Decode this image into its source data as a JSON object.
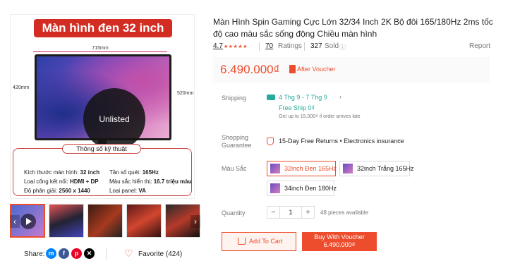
{
  "gallery": {
    "banner_title": "Màn hình đen 32 inch",
    "dim_width": "715mm",
    "dim_height_left": "420mm",
    "dim_height_right": "520mm",
    "watermark": "Unlisted",
    "spec_title": "Thông số kỹ thuật",
    "specs": [
      {
        "label": "Kích thước màn hình: ",
        "value": "32 inch"
      },
      {
        "label": "Tần số quét: ",
        "value": "165Hz"
      },
      {
        "label": "Loại cổng kết nối: ",
        "value": "HDMI + DP"
      },
      {
        "label": "Màu sắc hiển thị: ",
        "value": "16.7 triệu màu"
      },
      {
        "label": "Độ phân giải: ",
        "value": "2560 x 1440"
      },
      {
        "label": "Loại panel: ",
        "value": "VA"
      }
    ],
    "nav_prev": "‹",
    "nav_next": "›"
  },
  "share": {
    "label": "Share:",
    "icons": [
      "messenger-icon",
      "facebook-icon",
      "pinterest-icon",
      "x-icon"
    ],
    "icon_glyphs": [
      "m",
      "f",
      "p",
      "✕"
    ]
  },
  "favorite": {
    "label": "Favorite (424)",
    "heart": "♡"
  },
  "product": {
    "title": "Màn Hình Spin Gaming Cực Lớn 32/34 Inch 2K Bộ đôi 165/180Hz 2ms tốc độ cao màu sắc sống động Chiều màn hình",
    "rating": "4.7",
    "stars": "★★★★★",
    "ratings_count": "70",
    "ratings_label": "Ratings",
    "sold_count": "327",
    "sold_label": "Sold",
    "info_glyph": "ⓘ",
    "report": "Report",
    "price": "6.490.000₫",
    "after_voucher": "After Voucher"
  },
  "shipping": {
    "label": "Shipping",
    "date": "4 Thg 9 - 7 Thg 9",
    "free_ship": "Free Ship 0₫",
    "note": "Get up to 15.000₫ if order arrives late",
    "chevron": "›"
  },
  "guarantee": {
    "label": "Shopping Guarantee",
    "text": "15-Day Free Returns • Electronics insurance",
    "chevron": "⌄"
  },
  "variants": {
    "label": "Màu Sắc",
    "options": [
      {
        "label": "32inch Đen 165Hz",
        "selected": true
      },
      {
        "label": "32inch Trắng 165Hz",
        "selected": false
      },
      {
        "label": "34inch Đen 180Hz",
        "selected": false
      }
    ]
  },
  "quantity": {
    "label": "Quantity",
    "minus": "−",
    "value": "1",
    "plus": "+",
    "available": "48 pieces available"
  },
  "actions": {
    "add_to_cart": "Add To Cart",
    "buy_label": "Buy With Voucher",
    "buy_price": "6.490.000₫"
  },
  "colors": {
    "accent": "#ee4d2d",
    "ship_green": "#26aa99",
    "banner_red": "#d32d23"
  }
}
